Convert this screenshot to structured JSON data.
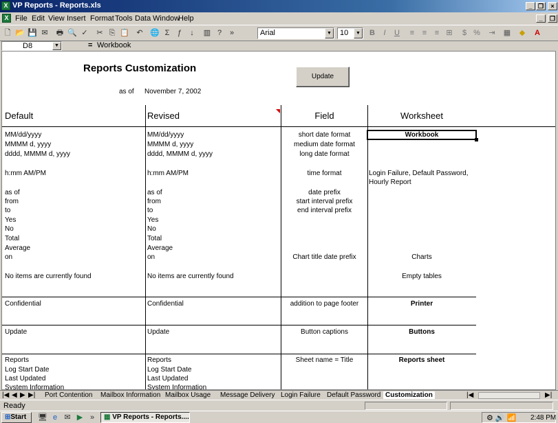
{
  "window": {
    "title": "VP Reports - Reports.xls",
    "app_icon": "excel-icon"
  },
  "menu": [
    "File",
    "Edit",
    "View",
    "Insert",
    "Format",
    "Tools",
    "Data",
    "Window",
    "Help"
  ],
  "toolbar": {
    "font_name": "Arial",
    "font_size": "10"
  },
  "formula": {
    "cell_ref": "D8",
    "equals": "=",
    "content": "Workbook"
  },
  "sheet": {
    "title": "Reports Customization",
    "as_of_label": "as of",
    "as_of_date": "November 7, 2002",
    "update_button": "Update",
    "headers": {
      "default": "Default",
      "revised": "Revised",
      "field": "Field",
      "worksheet": "Worksheet"
    },
    "rows": [
      {
        "default": "MM/dd/yyyy",
        "revised": "MM/dd/yyyy",
        "field": "short date format",
        "worksheet": "Workbook",
        "ws_bold": true
      },
      {
        "default": "MMMM d, yyyy",
        "revised": "MMMM d, yyyy",
        "field": "medium date format",
        "worksheet": ""
      },
      {
        "default": "dddd, MMMM d, yyyy",
        "revised": "dddd, MMMM d, yyyy",
        "field": "long date format",
        "worksheet": ""
      },
      {
        "default": "h:mm AM/PM",
        "revised": "h:mm AM/PM",
        "field": "time format",
        "worksheet": "Login Failure, Default Password,",
        "worksheet2": "Hourly Report"
      },
      {
        "default": "as of",
        "revised": "as of",
        "field": "date prefix",
        "worksheet": ""
      },
      {
        "default": "from",
        "revised": "from",
        "field": "start interval prefix",
        "worksheet": ""
      },
      {
        "default": "to",
        "revised": "to",
        "field": "end interval prefix",
        "worksheet": ""
      },
      {
        "default": "Yes",
        "revised": "Yes",
        "field": "",
        "worksheet": ""
      },
      {
        "default": "No",
        "revised": "No",
        "field": "",
        "worksheet": ""
      },
      {
        "default": "Total",
        "revised": "Total",
        "field": "",
        "worksheet": ""
      },
      {
        "default": "Average",
        "revised": "Average",
        "field": "",
        "worksheet": ""
      },
      {
        "default": "on",
        "revised": "on",
        "field": "Chart title date prefix",
        "worksheet": "Charts"
      },
      {
        "default": "No items are currently found",
        "revised": "No items are currently found",
        "field": "",
        "worksheet": "Empty tables"
      },
      {
        "default": "Confidential",
        "revised": "Confidential",
        "field": "addition to page footer",
        "worksheet": "Printer",
        "ws_bold": true
      },
      {
        "default": "Update",
        "revised": "Update",
        "field": "Button captions",
        "worksheet": "Buttons",
        "ws_bold": true
      },
      {
        "default": "Reports",
        "revised": "Reports",
        "field": "Sheet name = Title",
        "worksheet": "Reports sheet",
        "ws_bold": true
      },
      {
        "default": "Log Start Date",
        "revised": "Log Start Date",
        "field": "",
        "worksheet": ""
      },
      {
        "default": "Last Updated",
        "revised": "Last Updated",
        "field": "",
        "worksheet": ""
      },
      {
        "default": "System Information",
        "revised": "System Information",
        "field": "",
        "worksheet": ""
      }
    ]
  },
  "tabs": [
    "Port Contention",
    "Mailbox Information",
    "Mailbox Usage",
    "Message Delivery",
    "Login Failure",
    "Default Password",
    "Customization"
  ],
  "active_tab": "Customization",
  "status": "Ready",
  "taskbar": {
    "start": "Start",
    "task": "VP Reports - Reports....",
    "clock": "2:48 PM"
  }
}
